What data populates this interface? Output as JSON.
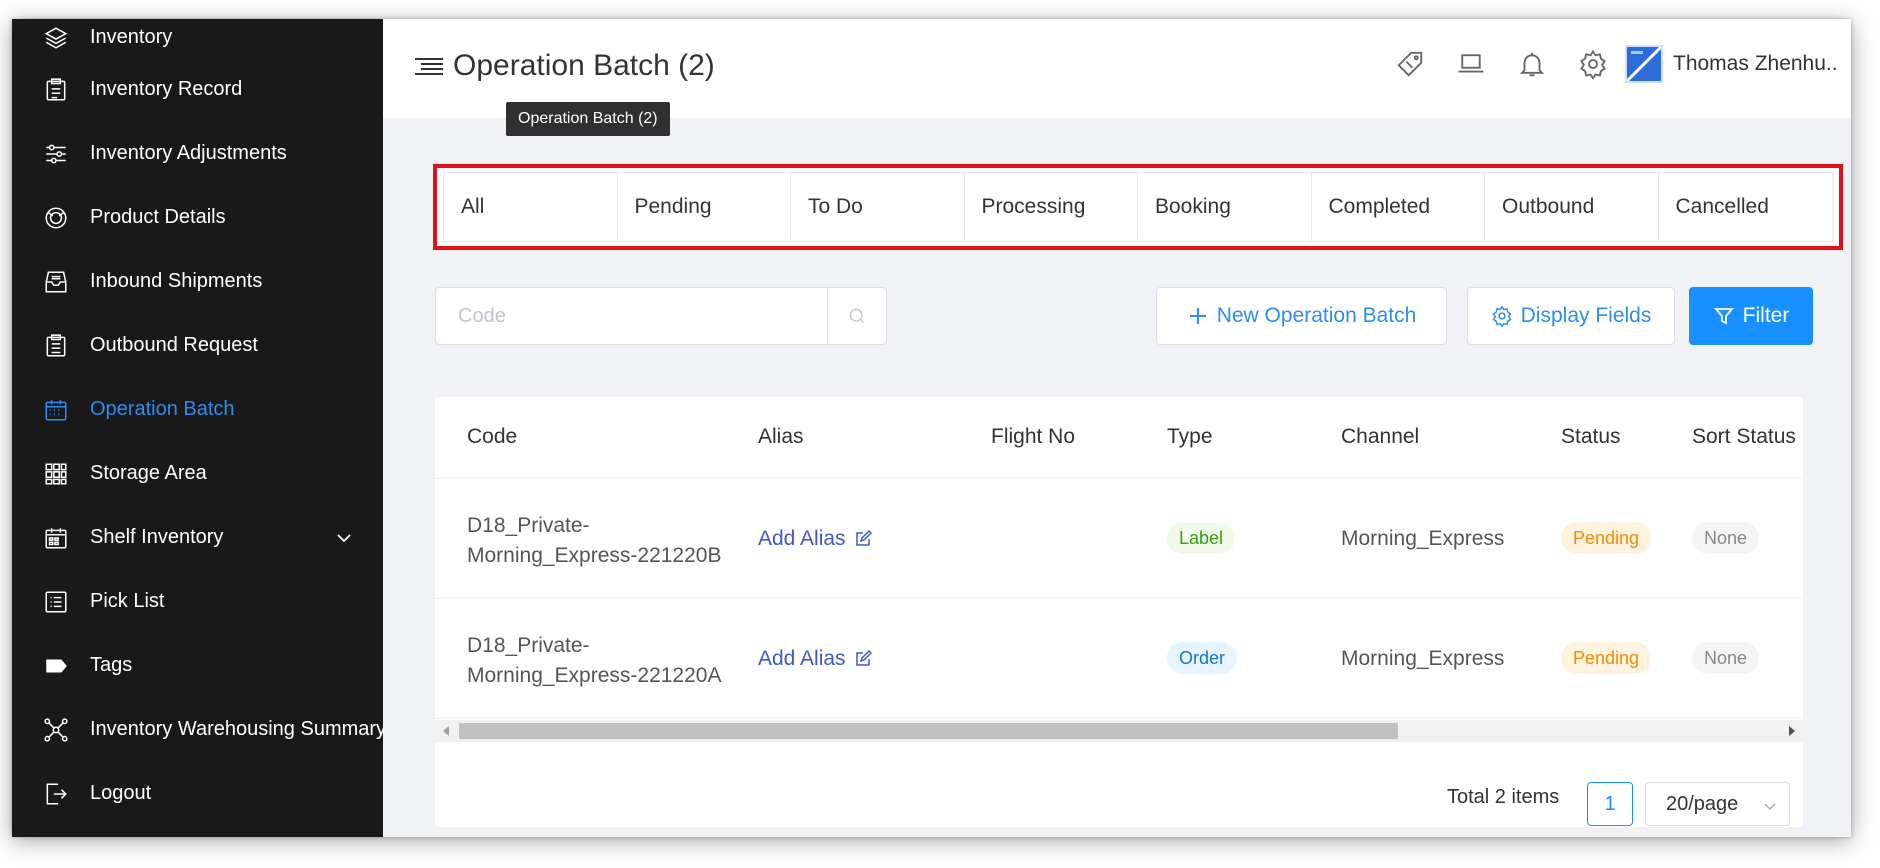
{
  "sidebar": {
    "items": [
      {
        "label": "Inventory",
        "icon": "layers-icon"
      },
      {
        "label": "Inventory Record",
        "icon": "clipboard-icon"
      },
      {
        "label": "Inventory Adjustments",
        "icon": "sliders-icon"
      },
      {
        "label": "Product Details",
        "icon": "product-icon"
      },
      {
        "label": "Inbound Shipments",
        "icon": "inbox-icon"
      },
      {
        "label": "Outbound Request",
        "icon": "clipboard-list-icon"
      },
      {
        "label": "Operation Batch",
        "icon": "calendar-icon"
      },
      {
        "label": "Storage Area",
        "icon": "grid-icon"
      },
      {
        "label": "Shelf Inventory",
        "icon": "shelf-icon"
      },
      {
        "label": "Pick List",
        "icon": "list-icon"
      },
      {
        "label": "Tags",
        "icon": "tag-icon"
      },
      {
        "label": "Inventory Warehousing Summary",
        "icon": "network-icon"
      },
      {
        "label": "Logout",
        "icon": "logout-icon"
      }
    ],
    "active_color": "#2f8cf0"
  },
  "header": {
    "title": "Operation Batch (2)",
    "tooltip": "Operation Batch (2)",
    "user_name": "Thomas Zhenhu.."
  },
  "tabs": [
    "All",
    "Pending",
    "To Do",
    "Processing",
    "Booking",
    "Completed",
    "Outbound",
    "Cancelled"
  ],
  "toolbar": {
    "search_placeholder": "Code",
    "new_batch_label": "New Operation Batch",
    "display_fields_label": "Display Fields",
    "filter_label": "Filter"
  },
  "table": {
    "columns": [
      "Code",
      "Alias",
      "Flight No",
      "Type",
      "Channel",
      "Status",
      "Sort Status"
    ],
    "rows": [
      {
        "code_line1": "D18_Private-",
        "code_line2": "Morning_Express-221220B",
        "alias": "Add Alias",
        "flight_no": "",
        "type": "Label",
        "channel": "Morning_Express",
        "status": "Pending",
        "sort_status": "None"
      },
      {
        "code_line1": "D18_Private-",
        "code_line2": "Morning_Express-221220A",
        "alias": "Add Alias",
        "flight_no": "",
        "type": "Order",
        "channel": "Morning_Express",
        "status": "Pending",
        "sort_status": "None"
      }
    ]
  },
  "pagination": {
    "total": "Total 2 items",
    "current_page": "1",
    "page_size": "20/page"
  },
  "colors": {
    "primary": "#1890ff",
    "highlight_border": "#e0101b",
    "sidebar_bg": "#191919"
  }
}
